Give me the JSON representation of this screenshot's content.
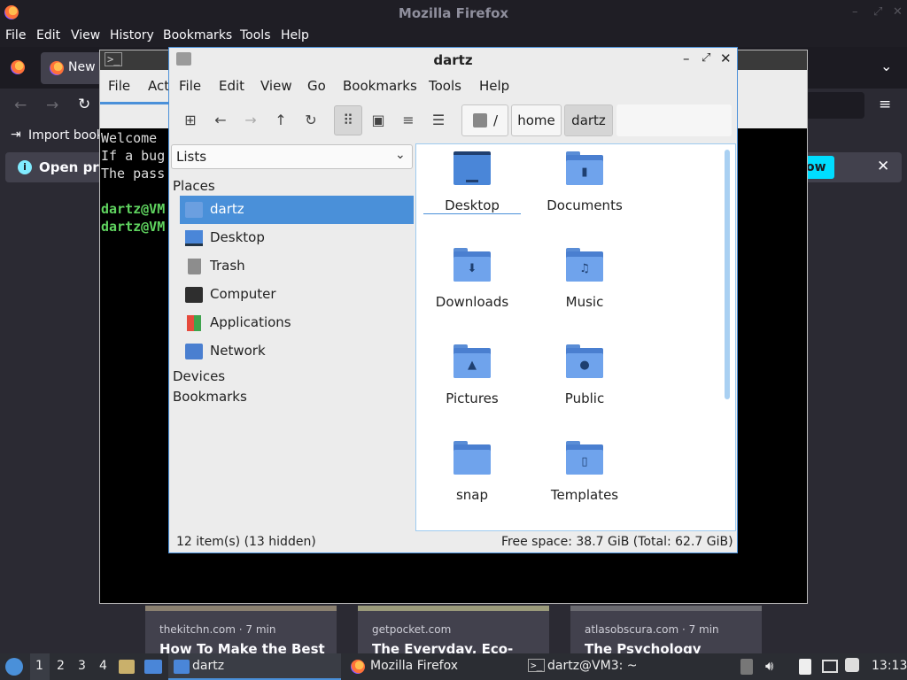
{
  "firefox": {
    "window_title": "Mozilla Firefox",
    "menu": [
      "File",
      "Edit",
      "View",
      "History",
      "Bookmarks",
      "Tools",
      "Help"
    ],
    "tab_label": "New",
    "import_bookmarks": "Import book",
    "notice_text": "Open pre",
    "notice_button": "ow",
    "cards": [
      {
        "source": "thekitchn.com · 7 min",
        "headline": "How To Make the Best"
      },
      {
        "source": "getpocket.com",
        "headline": "The Everyday, Eco-"
      },
      {
        "source": "atlasobscura.com · 7 min",
        "headline": "The Psychology"
      }
    ]
  },
  "terminal": {
    "menu": [
      "File",
      "Act"
    ],
    "lines": [
      "Welcome",
      "If a bug",
      "The pass"
    ],
    "prompts": [
      "dartz@VM",
      "dartz@VM"
    ]
  },
  "thunar": {
    "window_title": "dartz",
    "menu": [
      "File",
      "Edit",
      "View",
      "Go",
      "Bookmarks",
      "Tools",
      "Help"
    ],
    "breadcrumbs": [
      "/",
      "home",
      "dartz"
    ],
    "side_select": "Lists",
    "places_header": "Places",
    "places": [
      "dartz",
      "Desktop",
      "Trash",
      "Computer",
      "Applications",
      "Network"
    ],
    "devices_header": "Devices",
    "bookmarks_header": "Bookmarks",
    "files": [
      "Desktop",
      "Documents",
      "Downloads",
      "Music",
      "Pictures",
      "Public",
      "snap",
      "Templates"
    ],
    "status_left": "12 item(s) (13 hidden)",
    "status_right": "Free space: 38.7 GiB (Total: 62.7 GiB)"
  },
  "taskbar": {
    "workspaces": [
      "1",
      "2",
      "3",
      "4"
    ],
    "tasks": [
      "dartz",
      "Mozilla Firefox",
      "dartz@VM3: ~"
    ],
    "clock": "13:13"
  }
}
